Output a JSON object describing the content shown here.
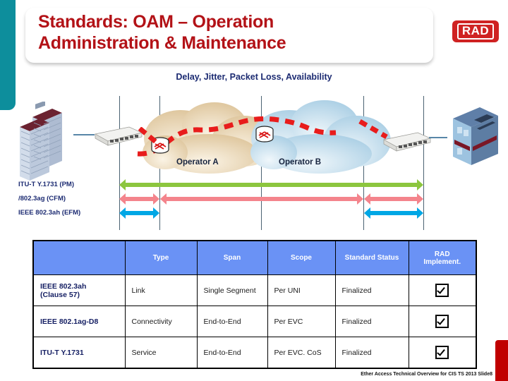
{
  "header": {
    "title": "Standards: OAM – Operation\nAdministration & Maintenance",
    "logo_text": "RAD",
    "title_color": "#b31217",
    "logo_color": "#cf2222"
  },
  "subtitle": "Delay, Jitter, Packet Loss, Availability",
  "diagram": {
    "cloud_a_label": "Operator A",
    "cloud_b_label": "Operator B",
    "cloud_a_color": "#e6d3ae",
    "cloud_b_color": "#b9d7ea",
    "path_color": "#e81c1c",
    "standards": [
      {
        "label": "ITU-T Y.1731 (PM)",
        "color": "#8cc63e"
      },
      {
        "label": "/802.3ag (CFM)",
        "color": "#f4848c"
      },
      {
        "label": "IEEE 802.3ah (EFM)",
        "color": "#00a7e5"
      }
    ]
  },
  "table": {
    "columns": [
      "",
      "Type",
      "Span",
      "Scope",
      "Standard Status",
      "RAD\nImplement."
    ],
    "header_bg": "#6a92f5",
    "rows": [
      {
        "standard": "IEEE 802.3ah\n(Clause 57)",
        "type": "Link",
        "span": "Single Segment",
        "scope": "Per UNI",
        "status": "Finalized",
        "rad": true
      },
      {
        "standard": "IEEE 802.1ag-D8",
        "type": "Connectivity",
        "span": "End-to-End",
        "scope": "Per EVC",
        "status": "Finalized",
        "rad": true
      },
      {
        "standard": "ITU-T Y.1731",
        "type": "Service",
        "span": "End-to-End",
        "scope": "Per EVC. CoS",
        "status": "Finalized",
        "rad": true
      }
    ]
  },
  "footer": "Ether Access Technical Overview for CIS TS 2013  Slide8"
}
